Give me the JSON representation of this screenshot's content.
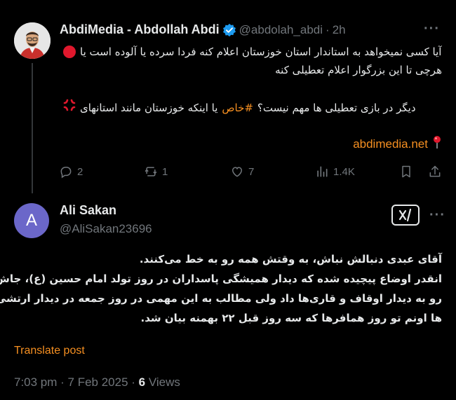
{
  "post": {
    "author_name": "AbdiMedia - Abdollah Abdi",
    "handle": "@abdolah_abdi",
    "separator": "·",
    "time_ago": "2h",
    "line1": "آیا کسی نمیخواهد به استاندار استان خوزستان اعلام کنه فردا سرده یا آلوده است یا",
    "line2": "هرچی تا این بزرگوار اعلام تعطیلی کنه",
    "line3_before": "یا اینکه خوزستان مانند استانهای",
    "hashtag": "#خاص",
    "line3_after": "دیگر در بازی تعطیلی ها مهم نیست؟",
    "link": "abdimedia.net",
    "replies": "2",
    "reposts": "1",
    "likes": "7",
    "views": "1.4K"
  },
  "reply": {
    "avatar_letter": "A",
    "author_name": "Ali Sakan",
    "handle": "@AliSakan23696",
    "line1": "آقای عبدی دنبالش نباش، به وقتش همه رو به خط می‌کنند.",
    "line2": "انقدر اوضاع پیچیده شده که دیدار همیشگی پاسداران در روز تولد امام حسین (ع)، جاش",
    "line3": "رو به دیدار اوقاف و قاری‌ها داد ولی مطالب به این مهمی در روز جمعه در دیدار ارتشی",
    "line4": "ها اونم تو روز همافرها که سه روز قبل ۲۲ بهمنه بیان شد.",
    "translate_label": "Translate post",
    "timestamp": "7:03 pm · 7 Feb 2025 ·",
    "views_count": "6",
    "views_label": "Views"
  },
  "icons": {
    "verified": "verified-badge-icon",
    "red_circle": "red-circle-icon",
    "anger": "anger-symbol-icon",
    "pin": "round-pushpin-icon",
    "reply": "reply-icon",
    "repost": "repost-icon",
    "like": "heart-icon",
    "views": "views-icon",
    "bookmark": "bookmark-icon",
    "share": "share-icon",
    "grok": "grok-icon",
    "more": "more-icon"
  },
  "colors": {
    "background": "#000000",
    "text": "#e7e9ea",
    "muted": "#71767b",
    "accent": "#f58f21",
    "verified": "#1d9bf0",
    "avatar": "#6b67c9"
  }
}
